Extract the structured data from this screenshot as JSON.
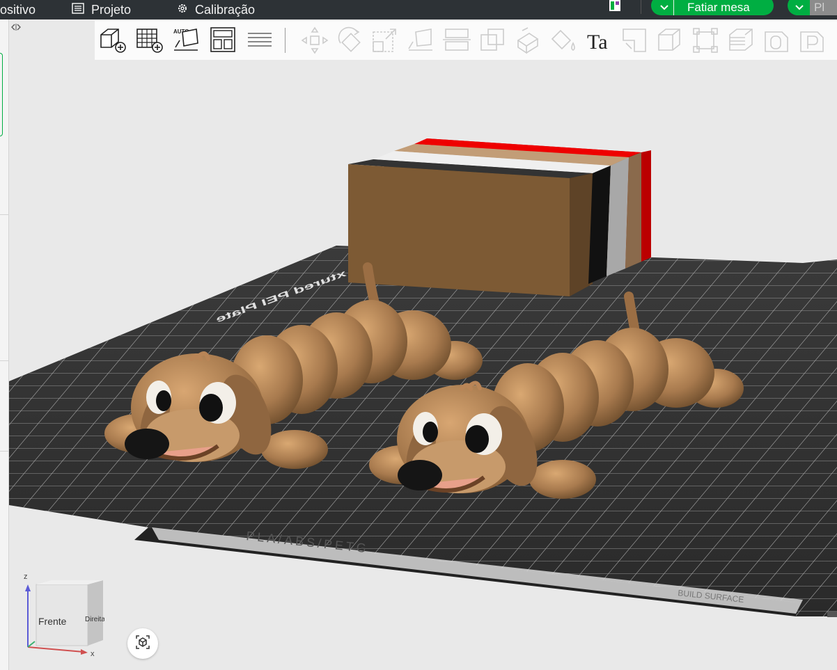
{
  "menu": {
    "device_label": "ositivo",
    "project_label": "Projeto",
    "calibration_label": "Calibração"
  },
  "actions": {
    "slice_label": "Fatiar mesa",
    "print_label": "Pl"
  },
  "toolbar": {
    "left_tools": [
      "add-object-icon",
      "add-plate-icon",
      "auto-orient-icon",
      "arrange-icon",
      "layers-list-icon"
    ],
    "right_tools": [
      "move-icon",
      "rotate-icon",
      "scale-icon",
      "lay-on-face-icon",
      "cut-icon",
      "boolean-icon",
      "supports-paint-icon",
      "color-paint-icon",
      "text-icon",
      "measure-icon",
      "assembly-icon",
      "fit-view-icon",
      "variable-layer-height-icon",
      "seam-icon",
      "part-icon"
    ],
    "auto_label": "AUTO",
    "text_tool_glyph": "Ta"
  },
  "scene": {
    "plate_label": "xtured PEI Plate",
    "plate_edge_label": "PLA/ABS/PETG",
    "plate_corner_label": "BUILD SURFACE",
    "wipe_tower_colors": [
      "#7d5a34",
      "#1e1e1e",
      "#d8d8d8",
      "#a27b57",
      "#c40000"
    ],
    "model_color": "#a87a4e"
  },
  "navcube": {
    "front_label": "Frente",
    "right_label": "Direita",
    "x_label": "x",
    "z_label": "z"
  }
}
